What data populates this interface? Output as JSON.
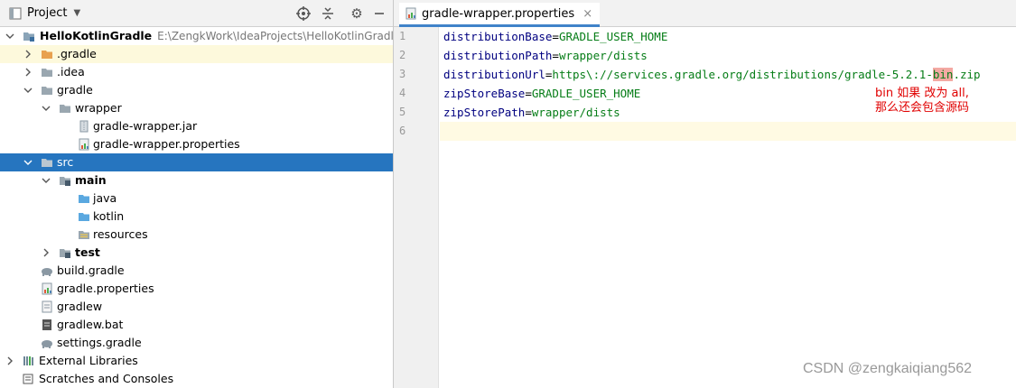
{
  "project_panel": {
    "title": "Project",
    "tree": [
      {
        "label": "HelloKotlinGradle",
        "path": "E:\\ZengkWork\\IdeaProjects\\HelloKotlinGradle",
        "icon": "module-folder-icon",
        "arrow": "down",
        "bold": true
      },
      {
        "label": ".gradle",
        "icon": "orange-folder-icon",
        "arrow": "right"
      },
      {
        "label": ".idea",
        "icon": "folder-icon",
        "arrow": "right"
      },
      {
        "label": "gradle",
        "icon": "folder-icon",
        "arrow": "down"
      },
      {
        "label": "wrapper",
        "icon": "folder-icon",
        "arrow": "down"
      },
      {
        "label": "gradle-wrapper.jar",
        "icon": "jar-file-icon"
      },
      {
        "label": "gradle-wrapper.properties",
        "icon": "properties-file-icon"
      },
      {
        "label": "src",
        "icon": "folder-icon",
        "arrow": "down"
      },
      {
        "label": "main",
        "icon": "source-folder-icon",
        "arrow": "down",
        "bold": true
      },
      {
        "label": "java",
        "icon": "blue-folder-icon"
      },
      {
        "label": "kotlin",
        "icon": "blue-folder-icon"
      },
      {
        "label": "resources",
        "icon": "resources-folder-icon"
      },
      {
        "label": "test",
        "icon": "source-folder-icon",
        "arrow": "right",
        "bold": true
      },
      {
        "label": "build.gradle",
        "icon": "gradle-elephant-icon"
      },
      {
        "label": "gradle.properties",
        "icon": "properties-file-icon"
      },
      {
        "label": "gradlew",
        "icon": "text-file-icon"
      },
      {
        "label": "gradlew.bat",
        "icon": "bat-file-icon"
      },
      {
        "label": "settings.gradle",
        "icon": "gradle-elephant-icon"
      },
      {
        "label": "External Libraries",
        "icon": "libraries-icon",
        "arrow": "right"
      },
      {
        "label": "Scratches and Consoles",
        "icon": "scratches-icon"
      }
    ]
  },
  "editor": {
    "tab_label": "gradle-wrapper.properties",
    "lines": [
      {
        "num": "1",
        "key": "distributionBase",
        "value": "GRADLE_USER_HOME"
      },
      {
        "num": "2",
        "key": "distributionPath",
        "value": "wrapper/dists"
      },
      {
        "num": "3",
        "key": "distributionUrl",
        "value_pre": "https\\://services.gradle.org/distributions/gradle-5.2.1-",
        "value_mark": "bin",
        "value_post": ".zip"
      },
      {
        "num": "4",
        "key": "zipStoreBase",
        "value": "GRADLE_USER_HOME"
      },
      {
        "num": "5",
        "key": "zipStorePath",
        "value": "wrapper/dists"
      },
      {
        "num": "6",
        "key": "",
        "value": ""
      }
    ],
    "annotation": "bin 如果 改为 all,\n那么还会包含源码"
  },
  "watermark": "CSDN @zengkaiqiang562",
  "colors": {
    "selection": "#2675bf",
    "highlight_row": "#fdf9dc",
    "key": "#000080",
    "value": "#067d17",
    "annotation": "#e00000"
  }
}
